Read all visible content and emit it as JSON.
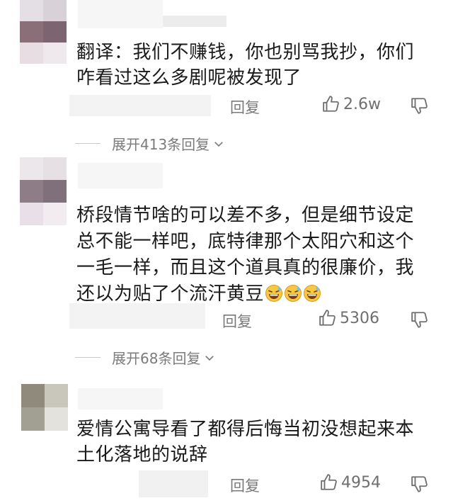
{
  "comments": [
    {
      "text_lines": [
        "翻译：我们不赚钱，你也别骂我抄，你们",
        "咋看过这么多剧呢被发现了"
      ],
      "reply_label": "回复",
      "likes": "2.6w",
      "expand_label": "展开413条回复"
    },
    {
      "text_lines": [
        "桥段情节啥的可以差不多，但是细节设定",
        "总不能一样吧，底特律那个太阳穴和这个",
        "一毛一样，而且这个道具真的很廉价，我",
        "还以为贴了个流汗黄豆"
      ],
      "reply_label": "回复",
      "likes": "5306",
      "expand_label": "展开68条回复"
    },
    {
      "text_lines": [
        "爱情公寓导看了都得后悔当初没想起来本",
        "土化落地的说辞"
      ],
      "reply_label": "回复",
      "likes": "4954"
    }
  ],
  "icons": {
    "like": "thumbs-up-icon",
    "dislike": "thumbs-down-icon",
    "expand": "chevron-down-icon",
    "emoji": "sweat-smile-emoji-icon"
  }
}
